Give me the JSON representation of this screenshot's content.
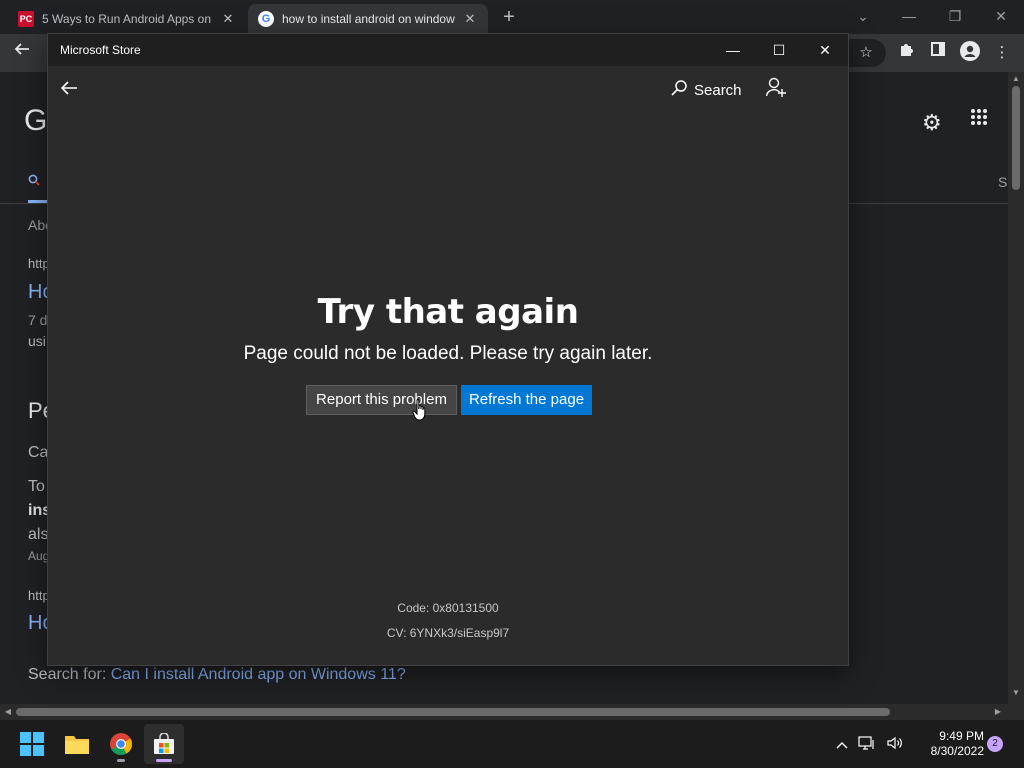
{
  "browser": {
    "tabs": [
      {
        "favicon": "PC",
        "title": "5 Ways to Run Android Apps on"
      },
      {
        "favicon": "G",
        "title": "how to install android on window"
      }
    ],
    "new_tab": "+",
    "google_logo": "G",
    "page_fragments": [
      "Abo",
      "http",
      "Ho",
      "7 d",
      "usi",
      "Pe",
      "Ca",
      "To",
      "ins",
      "als",
      "Aug",
      "http",
      "Ho"
    ],
    "s_tab": "S",
    "search_for_label": "Search for:",
    "search_for_link": "Can I install Android app on Windows 11?"
  },
  "store": {
    "window_title": "Microsoft Store",
    "search_label": "Search",
    "error_title": "Try that again",
    "error_message": "Page could not be loaded. Please try again later.",
    "report_button": "Report this problem",
    "refresh_button": "Refresh the page",
    "code": "Code: 0x80131500",
    "cv": "CV: 6YNXk3/siEasp9l7"
  },
  "taskbar": {
    "time": "9:49 PM",
    "date": "8/30/2022",
    "notification_count": "2"
  },
  "colors": {
    "accent": "#0078d4",
    "link": "#8ab4f8"
  }
}
